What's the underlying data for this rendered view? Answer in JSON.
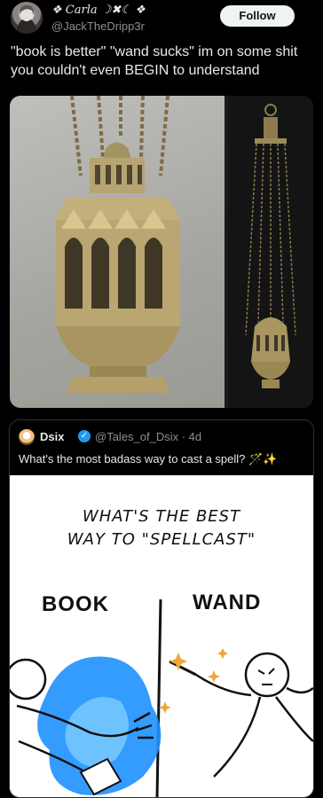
{
  "post": {
    "display_name": "❖ Carla ☽✖☾ ❖",
    "handle": "@JackTheDripp3r",
    "follow_label": "Follow",
    "text": "\"book is better\" \"wand sucks\" im on some shit you couldn't even BEGIN to understand"
  },
  "quote": {
    "display_name": "Dsix",
    "handle_time": "@Tales_of_Dsix · 4d",
    "text": "What's the most badass way to cast a spell? 🪄✨",
    "comic": {
      "title_line1": "WHAT'S THE BEST",
      "title_line2": "WAY TO \"SPELLCAST\"",
      "left_label": "BOOK",
      "right_label": "WAND"
    }
  },
  "colors": {
    "background": "#000000",
    "text": "#e7e9ea",
    "muted": "#8b8f94",
    "verified": "#1d9bf0",
    "magic_blue": "#1e90ff"
  }
}
